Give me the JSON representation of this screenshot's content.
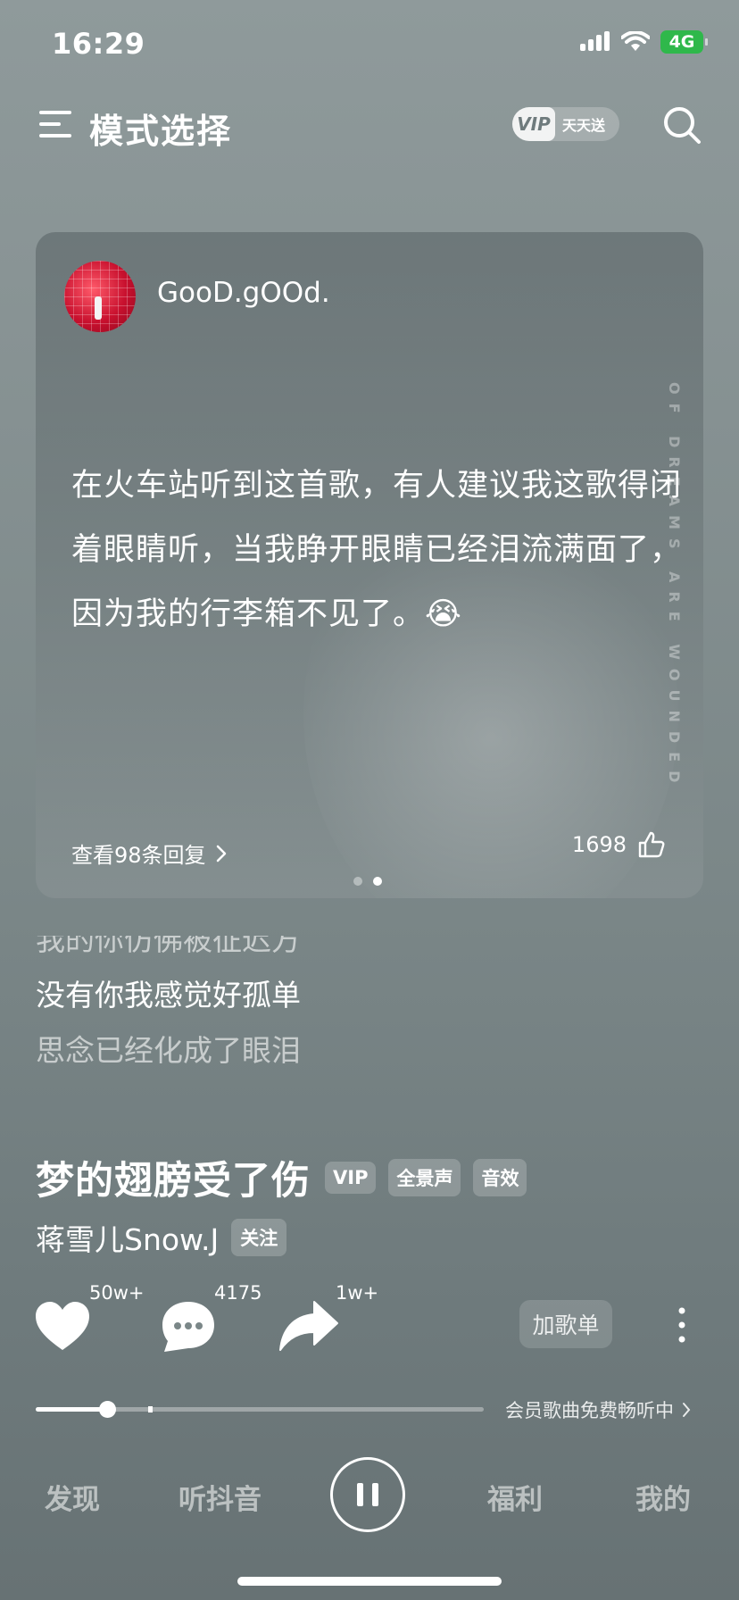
{
  "status_bar": {
    "time": "16:29",
    "network": "4G",
    "icons": [
      "signal-icon",
      "wifi-icon",
      "battery-icon"
    ]
  },
  "header": {
    "title": "模式选择",
    "vip_badge": "VIP",
    "vip_text": "天天送",
    "icons": [
      "menu-icon",
      "search-icon"
    ]
  },
  "comment_card": {
    "username": "GooD.gOOd.",
    "text": "在火车站听到这首歌，有人建议我这歌得闭着眼睛听，当我睁开眼睛已经泪流满面了，因为我的行李箱不见了。😭",
    "view_replies": "查看98条回复",
    "like_count": "1698",
    "decoration_text": "OF DREAMS ARE WOUNDED",
    "page_dots": 2,
    "active_dot": 1
  },
  "lyrics": {
    "lines": [
      "我的你仿佛被征迟方",
      "没有你我感觉好孤单",
      "思念已经化成了眼泪"
    ]
  },
  "song": {
    "title": "梦的翅膀受了伤",
    "tags": [
      "VIP",
      "全景声",
      "音效"
    ],
    "artist": "蒋雪儿Snow.J",
    "follow_label": "关注"
  },
  "actions": {
    "like_count": "50w+",
    "comment_count": "4175",
    "share_count": "1w+",
    "add_playlist_label": "加歌单"
  },
  "progress": {
    "position": 0.16,
    "buffer_marker": 0.25,
    "vip_free_text": "会员歌曲免费畅听中"
  },
  "bottom_nav": {
    "items": [
      "发现",
      "听抖音",
      "福利",
      "我的"
    ],
    "state": "playing"
  },
  "colors": {
    "background": "#889394",
    "battery": "#2fb84b",
    "avatar": "#c8102e"
  }
}
